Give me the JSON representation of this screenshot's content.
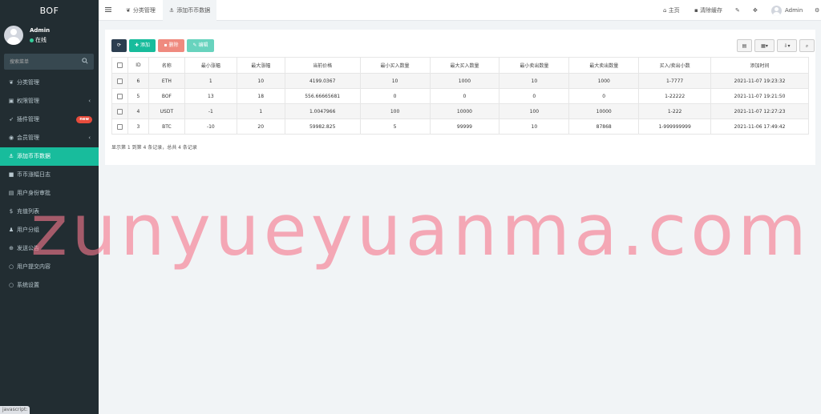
{
  "sidebar": {
    "brand": "BOF",
    "user": {
      "name": "Admin",
      "status": "在线"
    },
    "search_placeholder": "搜索菜单",
    "items": [
      {
        "label": "分类管理",
        "icon": "leaf-icon"
      },
      {
        "label": "权限管理",
        "icon": "group-icon",
        "caret": "‹"
      },
      {
        "label": "插件管理",
        "icon": "rocket-icon",
        "badge": "new"
      },
      {
        "label": "会员管理",
        "icon": "user-circle-icon",
        "caret": "‹"
      },
      {
        "label": "添加币币数据",
        "icon": "anchor-icon",
        "active": true
      },
      {
        "label": "币币涨幅日志",
        "icon": "list-icon"
      },
      {
        "label": "用户身份审批",
        "icon": "id-card-icon"
      },
      {
        "label": "充值列表",
        "icon": "money-icon"
      },
      {
        "label": "用户分组",
        "icon": "users-icon"
      },
      {
        "label": "发送公告",
        "icon": "plus-circle-icon"
      },
      {
        "label": "用户提交内容",
        "icon": "circle-icon"
      },
      {
        "label": "系统设置",
        "icon": "circle-icon"
      }
    ]
  },
  "statusbar": {
    "text": "javascript:"
  },
  "topbar": {
    "tabs": [
      {
        "label": "分类管理",
        "icon": "leaf-icon"
      },
      {
        "label": "添加币币数据",
        "icon": "anchor-icon",
        "active": true
      }
    ],
    "home": "主页",
    "clear_cache": "清除缓存",
    "user": "Admin"
  },
  "toolbar": {
    "add": "添加",
    "delete": "删除",
    "edit": "编辑"
  },
  "table": {
    "headers": [
      "ID",
      "名称",
      "最小涨幅",
      "最大涨幅",
      "当前价格",
      "最小买入数量",
      "最大买入数量",
      "最小卖出数量",
      "最大卖出数量",
      "买入/卖出小数",
      "添加时间"
    ],
    "rows": [
      [
        "6",
        "ETH",
        "1",
        "10",
        "4199.0367",
        "10",
        "1000",
        "10",
        "1000",
        "1-7777",
        "2021-11-07 19:23:32"
      ],
      [
        "5",
        "BOF",
        "13",
        "18",
        "556.66665681",
        "0",
        "0",
        "0",
        "0",
        "1-22222",
        "2021-11-07 19:21:50"
      ],
      [
        "4",
        "USDT",
        "-1",
        "1",
        "1.0047966",
        "100",
        "10000",
        "100",
        "10000",
        "1-222",
        "2021-11-07 12:27:23"
      ],
      [
        "3",
        "BTC",
        "-10",
        "20",
        "59982.825",
        "5",
        "99999",
        "10",
        "87868",
        "1-999999999",
        "2021-11-06 17:49:42"
      ]
    ]
  },
  "pager": {
    "summary": "显示第 1 到第 4 条记录，总共 4 条记录"
  },
  "watermark": "zunyueyuanma.com"
}
